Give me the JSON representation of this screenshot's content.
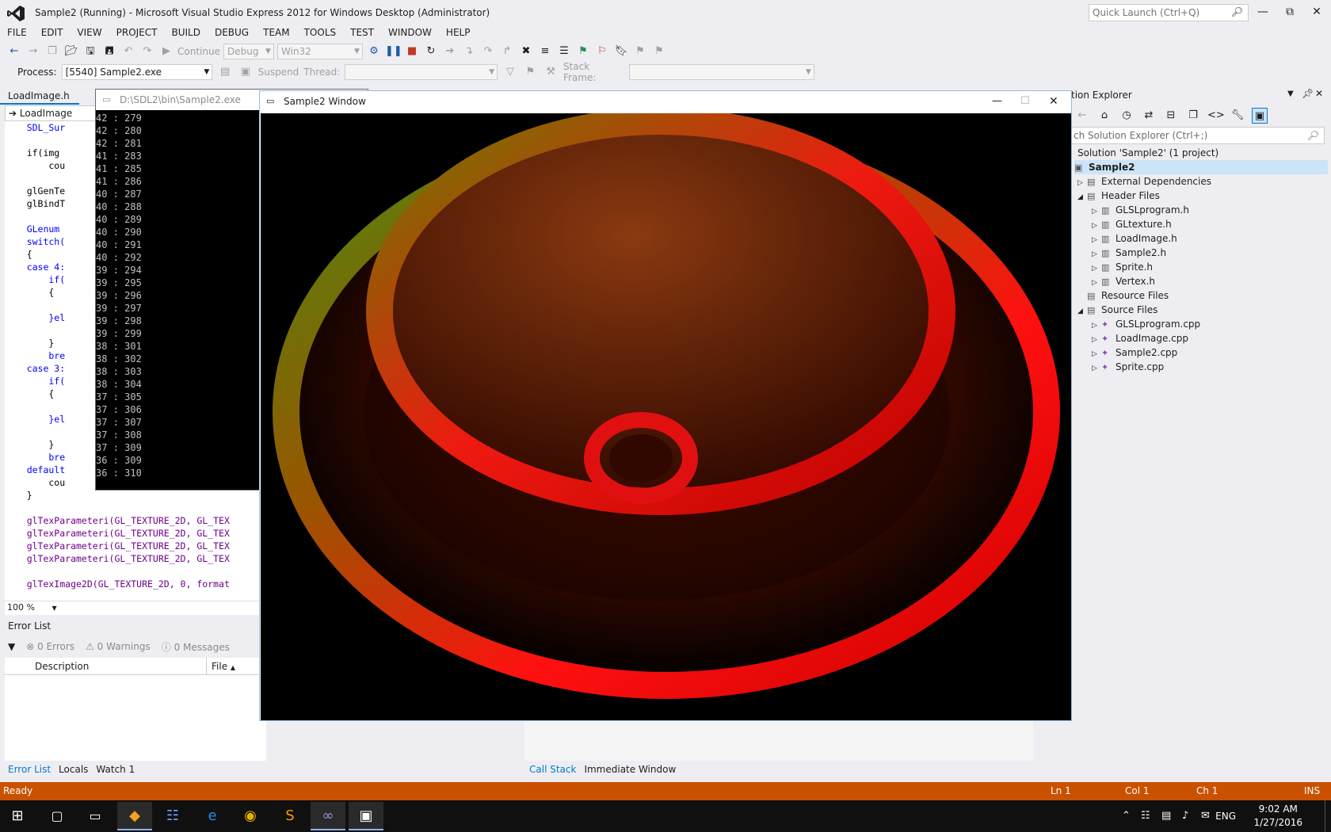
{
  "window": {
    "title": "Sample2 (Running) - Microsoft Visual Studio Express 2012 for Windows Desktop (Administrator)",
    "quick_launch_placeholder": "Quick Launch (Ctrl+Q)"
  },
  "menu": [
    "FILE",
    "EDIT",
    "VIEW",
    "PROJECT",
    "BUILD",
    "DEBUG",
    "TEAM",
    "TOOLS",
    "TEST",
    "WINDOW",
    "HELP"
  ],
  "toolbar": {
    "continue_label": "Continue",
    "config": "Debug",
    "platform": "Win32",
    "process_label": "Process:",
    "process_value": "[5540] Sample2.exe",
    "suspend_label": "Suspend",
    "thread_label": "Thread:",
    "stack_frame_label": "Stack Frame:"
  },
  "editor": {
    "tab": "LoadImage.h",
    "nav": "LoadImage",
    "zoom": "100 %",
    "lines": [
      "    SDL_Sur",
      "",
      "    if(img",
      "        cou",
      "",
      "    glGenTe",
      "    glBindT",
      "",
      "    GLenum",
      "    switch(",
      "    {",
      "    case 4:",
      "        if(",
      "        {",
      "",
      "        }el",
      "",
      "        }",
      "        bre",
      "    case 3:",
      "        if(",
      "        {",
      "",
      "        }el",
      "",
      "        }",
      "        bre",
      "    default",
      "        cou",
      "    }",
      "",
      "    glTexParameteri(GL_TEXTURE_2D, GL_TEX",
      "    glTexParameteri(GL_TEXTURE_2D, GL_TEX",
      "    glTexParameteri(GL_TEXTURE_2D, GL_TEX",
      "    glTexParameteri(GL_TEXTURE_2D, GL_TEX",
      "",
      "    glTexImage2D(GL_TEXTURE_2D, 0, format"
    ]
  },
  "error_list": {
    "title": "Error List",
    "errors": "0 Errors",
    "warnings": "0 Warnings",
    "messages": "0 Messages",
    "col_description": "Description",
    "col_file": "File"
  },
  "bottom_tabs_left": [
    "Error List",
    "Locals",
    "Watch 1"
  ],
  "bottom_tabs_right": [
    "Call Stack",
    "Immediate Window"
  ],
  "console": {
    "title": "D:\\SDL2\\bin\\Sample2.exe",
    "lines": [
      "42 : 279",
      "42 : 280",
      "42 : 281",
      "41 : 283",
      "41 : 285",
      "41 : 286",
      "40 : 287",
      "40 : 288",
      "40 : 289",
      "40 : 290",
      "40 : 291",
      "40 : 292",
      "39 : 294",
      "39 : 295",
      "39 : 296",
      "39 : 297",
      "39 : 298",
      "39 : 299",
      "38 : 301",
      "38 : 302",
      "38 : 303",
      "38 : 304",
      "37 : 305",
      "37 : 306",
      "37 : 307",
      "37 : 308",
      "37 : 309",
      "36 : 309",
      "36 : 310"
    ]
  },
  "game_window": {
    "title": "Sample2 Window"
  },
  "solution_explorer": {
    "title": "tion Explorer",
    "search_placeholder": "ch Solution Explorer (Ctrl+;)",
    "solution": "Solution 'Sample2' (1 project)",
    "project": "Sample2",
    "items": [
      {
        "label": "External Dependencies",
        "level": 1,
        "icon": "folder-icon"
      },
      {
        "label": "Header Files",
        "level": 1,
        "icon": "folder-icon"
      },
      {
        "label": "GLSLprogram.h",
        "level": 2,
        "icon": "header-file-icon"
      },
      {
        "label": "GLtexture.h",
        "level": 2,
        "icon": "header-file-icon"
      },
      {
        "label": "LoadImage.h",
        "level": 2,
        "icon": "header-file-icon"
      },
      {
        "label": "Sample2.h",
        "level": 2,
        "icon": "header-file-icon"
      },
      {
        "label": "Sprite.h",
        "level": 2,
        "icon": "header-file-icon"
      },
      {
        "label": "Vertex.h",
        "level": 2,
        "icon": "header-file-icon"
      },
      {
        "label": "Resource Files",
        "level": 1,
        "icon": "folder-icon"
      },
      {
        "label": "Source Files",
        "level": 1,
        "icon": "folder-icon"
      },
      {
        "label": "GLSLprogram.cpp",
        "level": 2,
        "icon": "cpp-file-icon"
      },
      {
        "label": "LoadImage.cpp",
        "level": 2,
        "icon": "cpp-file-icon"
      },
      {
        "label": "Sample2.cpp",
        "level": 2,
        "icon": "cpp-file-icon"
      },
      {
        "label": "Sprite.cpp",
        "level": 2,
        "icon": "cpp-file-icon"
      }
    ]
  },
  "statusbar": {
    "state": "Ready",
    "ln": "Ln 1",
    "col": "Col 1",
    "ch": "Ch 1",
    "mode": "INS",
    "color": "#ca5100"
  },
  "taskbar": {
    "lang": "ENG",
    "time": "9:02 AM",
    "date": "1/27/2016"
  }
}
